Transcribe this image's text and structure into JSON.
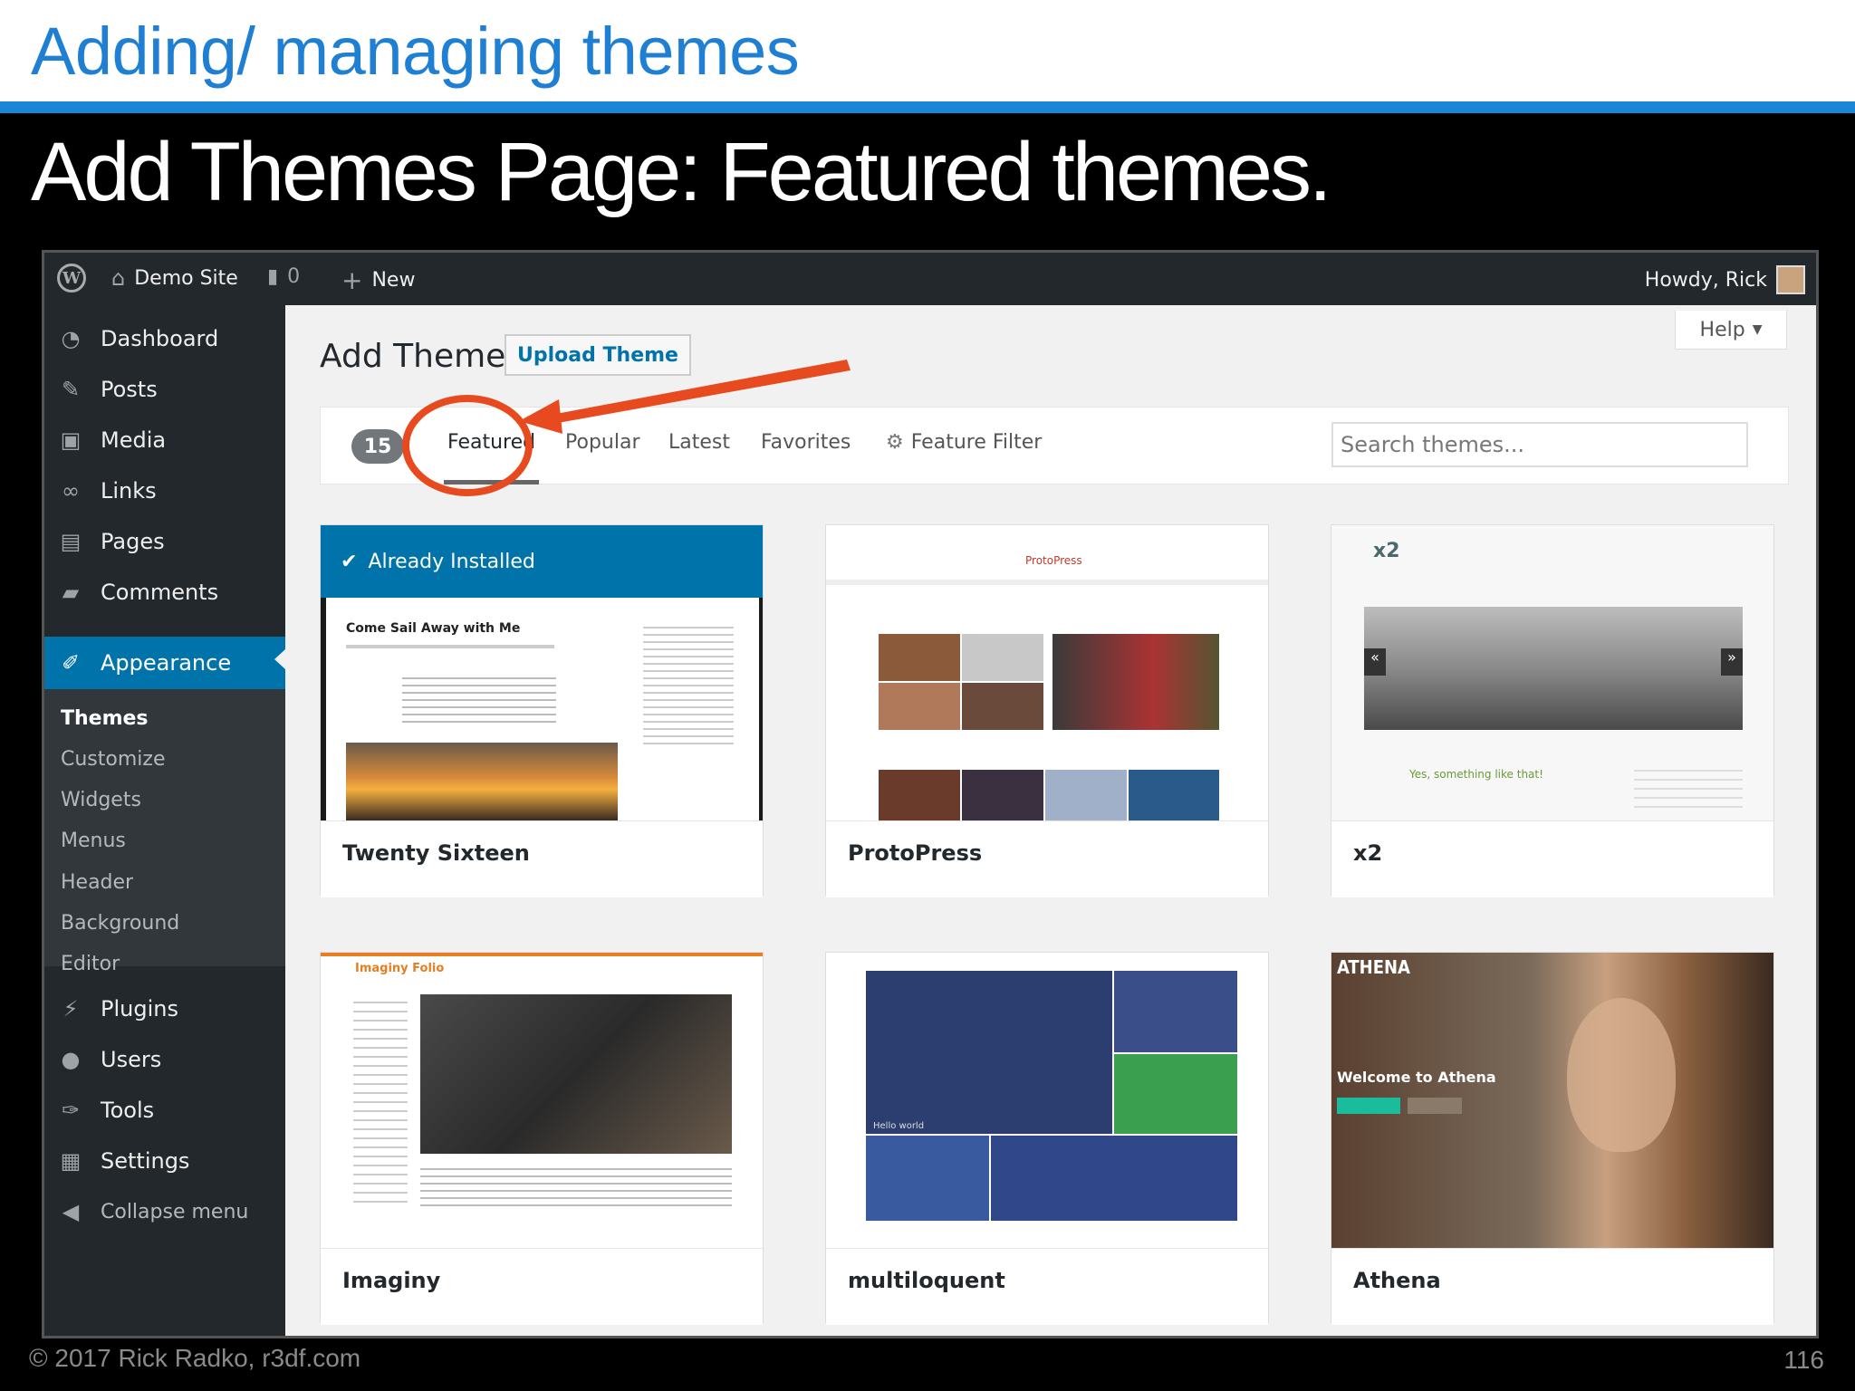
{
  "slide": {
    "title": "Adding/ managing themes",
    "subtitle": "Add Themes Page: Featured themes.",
    "footer_left": "© 2017 Rick Radko, r3df.com",
    "page_number": "116"
  },
  "adminbar": {
    "site_name": "Demo Site",
    "comments_count": "0",
    "new_label": "New",
    "greeting": "Howdy, Rick"
  },
  "sidebar": {
    "items": [
      {
        "label": "Dashboard",
        "icon": "dashboard-icon"
      },
      {
        "label": "Posts",
        "icon": "pin-icon"
      },
      {
        "label": "Media",
        "icon": "media-icon"
      },
      {
        "label": "Links",
        "icon": "link-icon"
      },
      {
        "label": "Pages",
        "icon": "pages-icon"
      },
      {
        "label": "Comments",
        "icon": "comment-icon"
      },
      {
        "label": "Appearance",
        "icon": "brush-icon"
      },
      {
        "label": "Plugins",
        "icon": "plug-icon"
      },
      {
        "label": "Users",
        "icon": "user-icon"
      },
      {
        "label": "Tools",
        "icon": "wrench-icon"
      },
      {
        "label": "Settings",
        "icon": "settings-icon"
      },
      {
        "label": "Collapse menu",
        "icon": "collapse-icon"
      }
    ],
    "submenu": [
      "Themes",
      "Customize",
      "Widgets",
      "Menus",
      "Header",
      "Background",
      "Editor"
    ]
  },
  "main": {
    "help_label": "Help",
    "page_title": "Add Themes",
    "upload_label": "Upload Theme",
    "count": "15",
    "tabs": [
      "Featured",
      "Popular",
      "Latest",
      "Favorites",
      "Feature Filter"
    ],
    "search_placeholder": "Search themes..."
  },
  "themes": [
    {
      "name": "Twenty Sixteen",
      "installed_label": "Already Installed",
      "preview_heading": "Come Sail Away with Me"
    },
    {
      "name": "ProtoPress",
      "preview_heading": "ProtoPress"
    },
    {
      "name": "x2",
      "preview_heading": "x2",
      "preview_comment": "Yes, something like that!"
    },
    {
      "name": "Imaginy",
      "preview_heading": "Imaginy Folio"
    },
    {
      "name": "multiloquent",
      "preview_heading": "Hello world"
    },
    {
      "name": "Athena",
      "preview_heading": "ATHENA",
      "preview_caption": "Welcome to Athena"
    }
  ],
  "colors": {
    "title_blue": "#1e7fd3",
    "wp_blue": "#0073aa",
    "annotation_red": "#e84a1f",
    "admin_dark": "#23282d"
  }
}
